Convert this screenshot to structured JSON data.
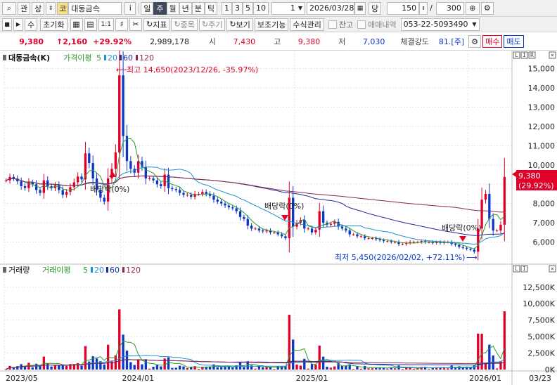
{
  "toolbar": {
    "search_icon": "magnifier-icon",
    "btn_gwan": "관",
    "btn_sang": "상",
    "code_prefix": "코",
    "stock_name": "대동금속",
    "info_label": "i",
    "periods": [
      "일",
      "주",
      "월",
      "년",
      "분",
      "틱"
    ],
    "active_period": "주",
    "intervals": [
      "1",
      "3",
      "5",
      "10"
    ],
    "unit_value": "1",
    "date_value": "2026/03/28",
    "dang_label": "당",
    "count_value": "150",
    "total_value": "300"
  },
  "toolbar2": {
    "su_label": "수",
    "reset_label": "초기화",
    "one_one": "1:1",
    "indicator_label": "지표",
    "item_label": "종목",
    "period_label": "주기",
    "view_label": "보기",
    "aux_label": "보조기능",
    "formula_label": "수식관리",
    "balance_label": "잔고",
    "trade_history_label": "매매내역",
    "account_value": "053-22-5093490"
  },
  "info": {
    "price": "9,380",
    "change": "↑2,160",
    "change_pct": "+29.92%",
    "volume": "2,989,178",
    "open_label": "시",
    "open": "7,430",
    "high_label": "고",
    "high": "9,380",
    "low_label": "저",
    "low": "7,030",
    "strength_label": "체결강도",
    "strength": "81.[주]",
    "buy_label": "매수",
    "sell_label": "매도"
  },
  "colors": {
    "up": "#e0002a",
    "down": "#0a37c8",
    "ma5": "#2e9a2e",
    "ma20": "#1e8fd0",
    "ma60": "#1e2a9a",
    "ma120": "#8a2a4a"
  },
  "chart_data": [
    {
      "type": "candlestick",
      "title": "대동금속(K)",
      "legend": [
        {
          "name": "가격이평",
          "period": "5",
          "color": "#2e9a2e"
        },
        {
          "name": "",
          "period": "20",
          "color": "#1e8fd0"
        },
        {
          "name": "",
          "period": "60",
          "color": "#1e2a9a"
        },
        {
          "name": "",
          "period": "120",
          "color": "#8a2a4a"
        }
      ],
      "y_ticks": [
        "15,000",
        "14,000",
        "13,000",
        "12,000",
        "11,000",
        "10,000",
        "9,000",
        "8,000",
        "7,000",
        "6,000"
      ],
      "ylim": [
        5000,
        15350
      ],
      "x_ticks": [
        "2023/05",
        "2024/01",
        "2025/01",
        "2026/01",
        "03/23"
      ],
      "x_start": "2023/05/01",
      "x_end": "2026/03/23",
      "annotations": [
        {
          "text": "최고 14,650(2023/12/26, -35.97%)"
        },
        {
          "text": "최저 5,450(2026/02/02, +72.11%)"
        },
        {
          "text": "배당락(0%)"
        },
        {
          "text": "배당락(0%)"
        },
        {
          "text": "배당락(0%)"
        }
      ],
      "last_price_label": "9,380",
      "last_change_label": "(29.92%)",
      "close": [
        9200,
        9380,
        9300,
        9150,
        8900,
        8800,
        9100,
        9000,
        8700,
        8550,
        9200,
        8900,
        8800,
        8950,
        8700,
        8450,
        8600,
        8850,
        9100,
        9400,
        9250,
        10600,
        10100,
        9300,
        8700,
        8300,
        8100,
        9300,
        9800,
        10650,
        14650,
        11500,
        10200,
        9800,
        9600,
        10200,
        9900,
        9300,
        9300,
        9200,
        9000,
        8900,
        9500,
        8800,
        8750,
        8700,
        8550,
        8450,
        8450,
        8350,
        8500,
        8500,
        8600,
        8500,
        8400,
        8200,
        8100,
        8000,
        7900,
        7800,
        7750,
        7600,
        7300,
        7200,
        6850,
        6700,
        6700,
        6600,
        6550,
        6600,
        6500,
        6500,
        6400,
        6300,
        6200,
        8300,
        6800,
        7000,
        7150,
        6700,
        6700,
        6500,
        6650,
        7600,
        7000,
        6900,
        6950,
        7050,
        6800,
        6700,
        6600,
        6400,
        6400,
        6300,
        6300,
        6200,
        6200,
        6200,
        6150,
        6100,
        6050,
        6050,
        6000,
        6000,
        5900,
        5900,
        5950,
        6000,
        6000,
        6000,
        6050,
        6000,
        6000,
        5950,
        6000,
        5950,
        6000,
        6000,
        5900,
        5850,
        5750,
        5700,
        5650,
        5600,
        5500,
        6700,
        8200,
        8500,
        7200,
        6600,
        6600,
        6900,
        9380
      ],
      "volume_panel": {
        "legend": [
          {
            "name": "거래량",
            "color": "#111"
          },
          {
            "name": "거래이평",
            "period": "5",
            "color": "#2e9a2e"
          },
          {
            "name": "",
            "period": "20",
            "color": "#1e8fd0"
          },
          {
            "name": "",
            "period": "60",
            "color": "#1e2a9a"
          },
          {
            "name": "",
            "period": "120",
            "color": "#8a2a4a"
          }
        ],
        "y_ticks": [
          "12,500K",
          "10,000K",
          "7,500K",
          "5,000K",
          "2,500K",
          "0K"
        ],
        "ylim": [
          0,
          14500
        ],
        "unit": "K"
      }
    }
  ]
}
